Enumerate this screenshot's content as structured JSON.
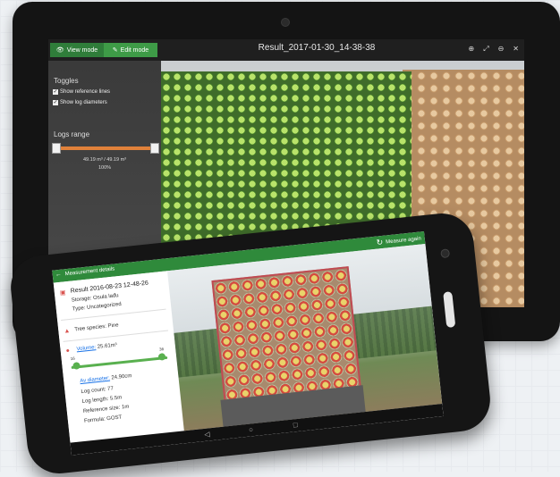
{
  "tablet": {
    "view_mode_label": "View mode",
    "edit_mode_label": "Edit mode",
    "title": "Result_2017-01-30_14-38-38",
    "tools": [
      "zoom-in-icon",
      "fit-icon",
      "zoom-out-icon",
      "close-icon"
    ],
    "sidebar": {
      "toggles_heading": "Toggles",
      "toggle_reference_lines": "Show reference lines",
      "toggle_log_diameters": "Show log diameters",
      "logs_range_heading": "Logs range",
      "range_value": "49.19 m³ / 49.19 m³",
      "range_percent": "100%"
    }
  },
  "phone": {
    "topbar_title": "Measurement details",
    "topbar_action": "Measure again",
    "result_title": "Result 2016-08-23 12-48-26",
    "storage": "Storage: Osula lađu",
    "type": "Type: Uncategorized",
    "tree_species": "Tree species: Pine",
    "volume_label": "Volume:",
    "volume_value": "25.61m³",
    "slider_min": "16",
    "slider_max": "36",
    "av_diameter_label": "Av diameter:",
    "av_diameter_value": "24.90cm",
    "log_count": "Log count: 77",
    "log_length": "Log length: 5.5m",
    "reference_size": "Reference size: 1m",
    "formula": "Formula: GOST"
  }
}
